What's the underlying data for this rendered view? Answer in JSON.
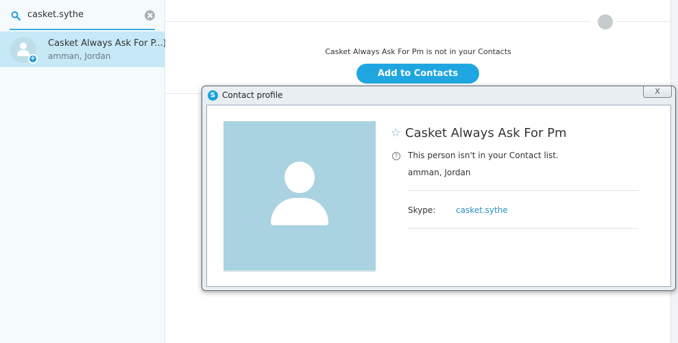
{
  "sidebar": {
    "search": {
      "value": "casket.sythe"
    },
    "result": {
      "name": "Casket Always Ask For P...)",
      "location": "amman, Jordan"
    }
  },
  "main": {
    "not_in_contacts": "Casket Always Ask For Pm is not in your Contacts",
    "add_button": "Add to Contacts"
  },
  "dialog": {
    "title": "Contact profile",
    "close_label": "X",
    "profile": {
      "name": "Casket Always Ask For Pm",
      "notice": "This person isn't in your Contact list.",
      "location": "amman, Jordan",
      "skype_label": "Skype:",
      "skype_value": "casket.sythe"
    }
  },
  "colors": {
    "accent": "#1fa6e0",
    "selection": "#c6e8f7",
    "avatar_bg": "#a9d3e1"
  }
}
